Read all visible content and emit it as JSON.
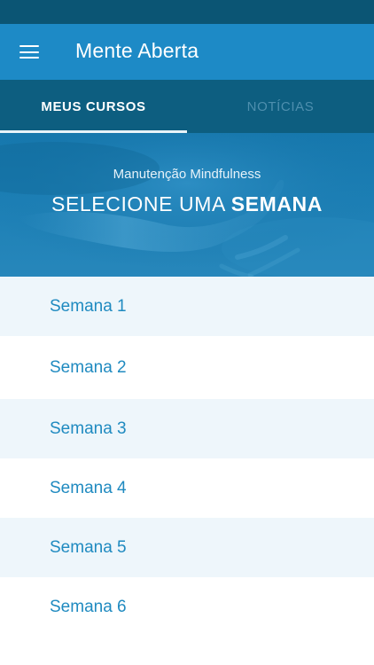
{
  "app": {
    "title": "Mente Aberta",
    "menu_icon": "hamburger-menu-icon",
    "colors": {
      "status_bar": "#0b5574",
      "app_bar": "#1d8ac6",
      "tab_bar": "#0d5e80",
      "accent_text": "#1f8ac0",
      "row_alt": "#eef6fb"
    }
  },
  "tabs": [
    {
      "label": "MEUS CURSOS",
      "selected": true
    },
    {
      "label": "NOTÍCIAS",
      "selected": false
    }
  ],
  "hero": {
    "subtitle": "Manutenção Mindfulness",
    "title_prefix": "SELECIONE UMA",
    "title_bold": "SEMANA"
  },
  "weeks": [
    {
      "label": "Semana 1"
    },
    {
      "label": "Semana 2"
    },
    {
      "label": "Semana 3"
    },
    {
      "label": "Semana 4"
    },
    {
      "label": "Semana 5"
    },
    {
      "label": "Semana 6"
    }
  ]
}
